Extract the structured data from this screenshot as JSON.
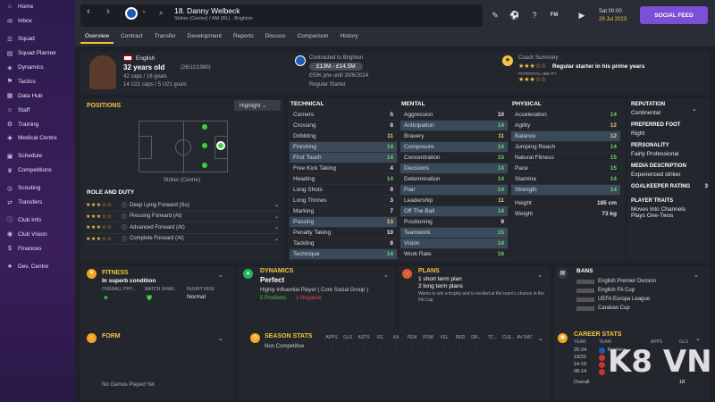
{
  "sidebar": {
    "items": [
      {
        "label": "Home",
        "icon": "home-icon"
      },
      {
        "label": "Inbox",
        "icon": "inbox-icon"
      },
      {
        "label": "Squad",
        "icon": "squad-icon"
      },
      {
        "label": "Squad Planner",
        "icon": "planner-icon"
      },
      {
        "label": "Dynamics",
        "icon": "dynamics-icon"
      },
      {
        "label": "Tactics",
        "icon": "tactics-icon"
      },
      {
        "label": "Data Hub",
        "icon": "datahub-icon"
      },
      {
        "label": "Staff",
        "icon": "staff-icon"
      },
      {
        "label": "Training",
        "icon": "training-icon"
      },
      {
        "label": "Medical Centre",
        "icon": "medical-icon"
      },
      {
        "label": "Schedule",
        "icon": "schedule-icon"
      },
      {
        "label": "Competitions",
        "icon": "trophy-icon"
      },
      {
        "label": "Scouting",
        "icon": "scouting-icon"
      },
      {
        "label": "Transfers",
        "icon": "transfers-icon"
      },
      {
        "label": "Club Info",
        "icon": "clubinfo-icon"
      },
      {
        "label": "Club Vision",
        "icon": "vision-icon"
      },
      {
        "label": "Finances",
        "icon": "finances-icon"
      },
      {
        "label": "Dev. Centre",
        "icon": "devcentre-icon"
      }
    ]
  },
  "header": {
    "title": "18. Danny Welbeck",
    "subtitle": "Striker (Centre) / AM (RL) - Brighton",
    "date_time": "Sat 00:00",
    "date": "29 Jul 2023",
    "social_feed": "SOCIAL FEED",
    "fm": "FM"
  },
  "tabs": [
    "Overview",
    "Contract",
    "Transfer",
    "Development",
    "Reports",
    "Discuss",
    "Comparison",
    "History"
  ],
  "profile": {
    "nationality": "English",
    "age": "32 years old",
    "dob": "(26/11/1990)",
    "caps": "42 caps / 16 goals",
    "u21": "14 U21 caps / 5 U21 goals",
    "contract_line": "Contracted to Brighton",
    "value": "£13M - £14.5M",
    "wage": "£50K p/w until 30/6/2024",
    "status": "Regular Starter",
    "coach_title": "Coach Summary",
    "coach_text": "Regular starter in his prime years",
    "potential": "POTENTIAL ABILITY"
  },
  "positions": {
    "title": "POSITIONS",
    "highlight": "Highlight",
    "nation": "English",
    "pos_label": "Striker (Centre)"
  },
  "roles": {
    "title": "ROLE AND DUTY",
    "items": [
      "Deep Lying Forward (Su)",
      "Pressing Forward (At)",
      "Advanced Forward (At)",
      "Complete Forward (At)"
    ]
  },
  "technical": {
    "title": "TECHNICAL",
    "rows": [
      [
        "Corners",
        "5"
      ],
      [
        "Crossing",
        "8"
      ],
      [
        "Dribbling",
        "11"
      ],
      [
        "Finishing",
        "14"
      ],
      [
        "First Touch",
        "14"
      ],
      [
        "Free Kick Taking",
        "4"
      ],
      [
        "Heading",
        "14"
      ],
      [
        "Long Shots",
        "9"
      ],
      [
        "Long Throws",
        "3"
      ],
      [
        "Marking",
        "7"
      ],
      [
        "Passing",
        "13"
      ],
      [
        "Penalty Taking",
        "10"
      ],
      [
        "Tackling",
        "8"
      ],
      [
        "Technique",
        "14"
      ]
    ]
  },
  "mental": {
    "title": "MENTAL",
    "rows": [
      [
        "Aggression",
        "10"
      ],
      [
        "Anticipation",
        "14"
      ],
      [
        "Bravery",
        "11"
      ],
      [
        "Composure",
        "14"
      ],
      [
        "Concentration",
        "15"
      ],
      [
        "Decisions",
        "14"
      ],
      [
        "Determination",
        "14"
      ],
      [
        "Flair",
        "14"
      ],
      [
        "Leadership",
        "11"
      ],
      [
        "Off The Ball",
        "14"
      ],
      [
        "Positioning",
        "9"
      ],
      [
        "Teamwork",
        "15"
      ],
      [
        "Vision",
        "14"
      ],
      [
        "Work Rate",
        "16"
      ]
    ]
  },
  "physical": {
    "title": "PHYSICAL",
    "rows": [
      [
        "Acceleration",
        "14"
      ],
      [
        "Agility",
        "12"
      ],
      [
        "Balance",
        "12"
      ],
      [
        "Jumping Reach",
        "14"
      ],
      [
        "Natural Fitness",
        "15"
      ],
      [
        "Pace",
        "15"
      ],
      [
        "Stamina",
        "14"
      ],
      [
        "Strength",
        "14"
      ]
    ],
    "height_label": "Height",
    "height": "185 cm",
    "weight_label": "Weight",
    "weight": "73 kg"
  },
  "side": {
    "rep_t": "REPUTATION",
    "rep": "Continental",
    "foot_t": "PREFERRED FOOT",
    "foot": "Right",
    "pers_t": "PERSONALITY",
    "pers": "Fairly Professional",
    "media_t": "MEDIA DESCRIPTION",
    "media": "Experienced striker",
    "gk_t": "GOALKEEPER RATING",
    "gk": "3",
    "traits_t": "PLAYER TRAITS",
    "traits": [
      "Moves Into Channels",
      "Plays One-Twos"
    ]
  },
  "fitness": {
    "title": "FITNESS",
    "cond": "In superb condition",
    "h1": "OVERALL PHY...",
    "h2": "MATCH SHAR...",
    "h3": "INJURY RISK",
    "risk": "Normal"
  },
  "dynamics": {
    "title": "DYNAMICS",
    "val": "Perfect",
    "desc": "Highly Influential Player ( Core Social Group )",
    "pos": "5 Positives",
    "neg": "1 Negative"
  },
  "plans": {
    "title": "PLANS",
    "p1": "1 short term plan",
    "p2": "2 long term plans",
    "desc": "Wants to win a trophy and is excited at the team's chance in the FA Cup"
  },
  "bans": {
    "title": "BANS",
    "items": [
      "English Premier Division",
      "English FA Cup",
      "UEFA Europa League",
      "Carabao Cup"
    ]
  },
  "form": {
    "title": "FORM",
    "empty": "No Games Played Yet"
  },
  "season": {
    "title": "SEASON STATS",
    "cols": [
      "APPS",
      "GLS",
      "ASTS",
      "XG",
      "XA",
      "PEN",
      "POM",
      "YEL",
      "RED",
      "DR...",
      "TC...",
      "CLE...",
      "AV RAT"
    ],
    "row": "Non Competitive"
  },
  "career": {
    "title": "CAREER STATS",
    "h1": "YEAR",
    "h2": "TEAM",
    "h3": "APPS",
    "h4": "GLS",
    "rows": [
      [
        "20-24",
        "Brighton",
        "",
        ""
      ],
      [
        "19/20",
        "",
        "",
        ""
      ],
      [
        "14-19",
        "",
        "",
        ""
      ],
      [
        "08-14",
        "",
        "",
        ""
      ]
    ],
    "overall": "Overall",
    "total": "18"
  },
  "watermark": "K8 VN"
}
